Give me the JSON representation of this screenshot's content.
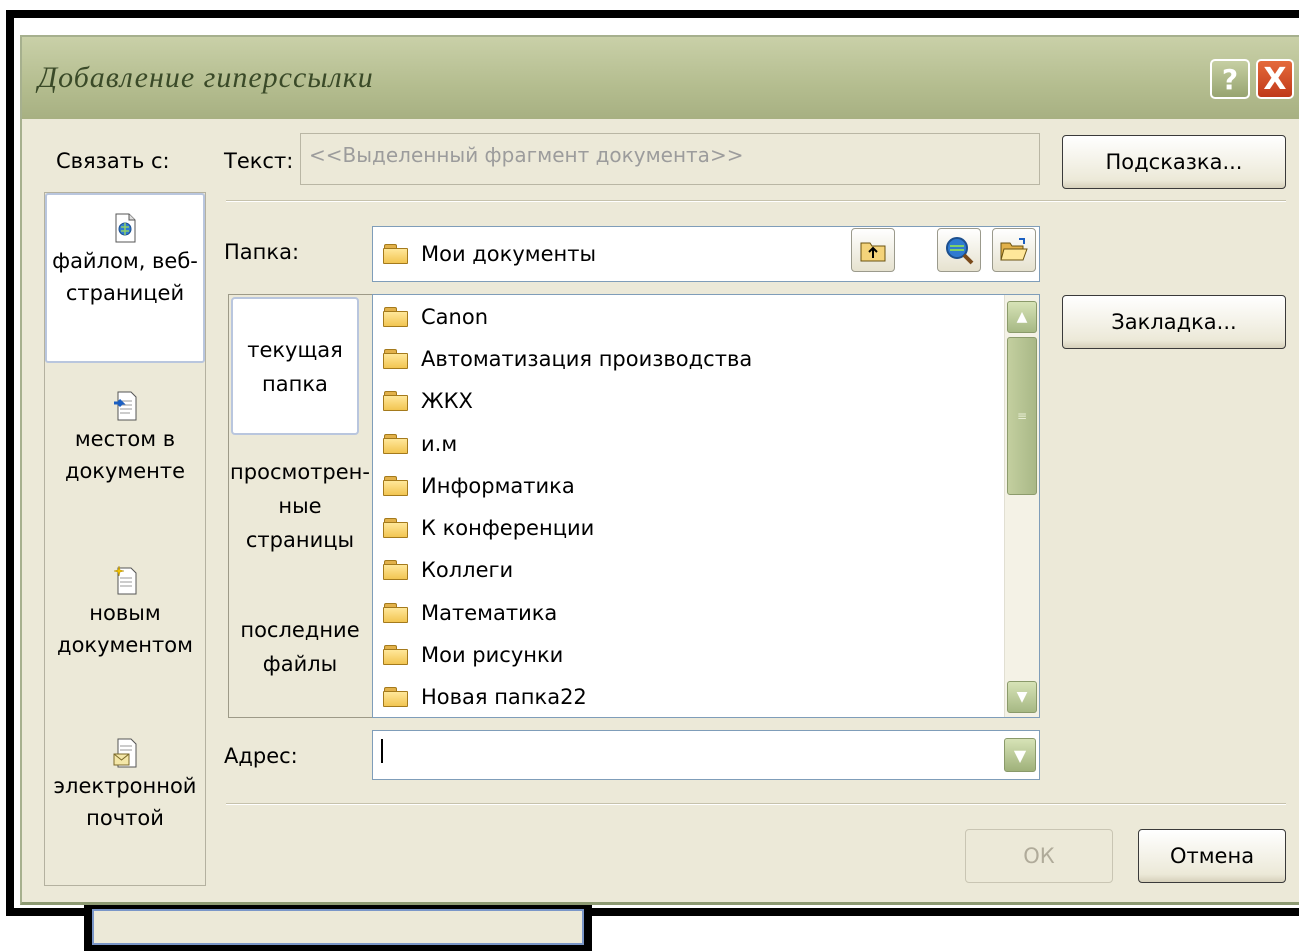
{
  "window": {
    "title": "Добавление гиперссылки",
    "help_glyph": "?",
    "close_glyph": "X"
  },
  "link_with": {
    "label": "Связать с:",
    "items": [
      {
        "label_line1": "файлом, веб-",
        "label_line2": "страницей",
        "icon": "web-page-icon",
        "selected": true
      },
      {
        "label_line1": "местом в",
        "label_line2": "документе",
        "icon": "place-in-document-icon",
        "selected": false
      },
      {
        "label_line1": "новым",
        "label_line2": "документом",
        "icon": "new-document-icon",
        "selected": false
      },
      {
        "label_line1": "электронной",
        "label_line2": "почтой",
        "icon": "email-icon",
        "selected": false
      }
    ]
  },
  "text_field": {
    "label": "Текст:",
    "value": "<<Выделенный фрагмент документа>>"
  },
  "buttons": {
    "tooltip": "Подсказка...",
    "bookmark": "Закладка...",
    "ok": "ОК",
    "cancel": "Отмена"
  },
  "folder": {
    "label": "Папка:",
    "value": "Мои документы",
    "tools": [
      "up-one-level-icon",
      "browse-web-icon",
      "browse-file-icon"
    ]
  },
  "places": [
    {
      "line1": "текущая",
      "line2": "папка",
      "line3": "",
      "selected": true
    },
    {
      "line1": "просмотрен-",
      "line2": "ные",
      "line3": "страницы",
      "selected": false
    },
    {
      "line1": "последние",
      "line2": "файлы",
      "line3": "",
      "selected": false
    }
  ],
  "files": [
    "Canon",
    "Автоматизация производства",
    "ЖКХ",
    "и.м",
    "Информатика",
    "К конференции",
    "Коллеги",
    "Математика",
    "Мои рисунки",
    "Новая папка22"
  ],
  "address": {
    "label": "Адрес:",
    "value": ""
  },
  "colors": {
    "dialog_bg": "#ece9d8",
    "titlebar": "#b4bd8f",
    "close_button": "#c0391a",
    "scroll_accent": "#a6b884"
  }
}
